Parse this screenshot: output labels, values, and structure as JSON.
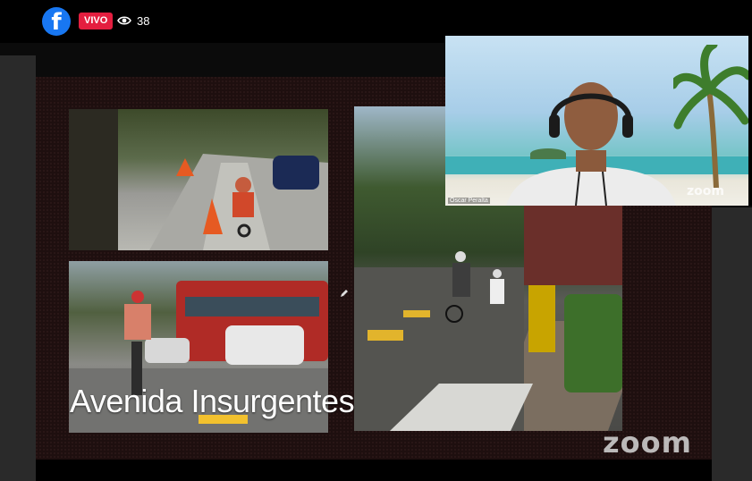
{
  "stream": {
    "platform_icon": "facebook-icon",
    "live_badge": "VIVO",
    "viewers_icon": "eye-icon",
    "viewer_count": "38"
  },
  "slide": {
    "caption": "Avenida Insurgentes",
    "watermark": "zoom",
    "photos": [
      {
        "name": "bike-lane-cyclists-photo"
      },
      {
        "name": "bus-and-cyclist-photo"
      },
      {
        "name": "street-crossing-cyclists-photo"
      }
    ]
  },
  "camera": {
    "participant_name": "Oscar Peralta",
    "brand_tag": "zoom",
    "colors": {
      "sky": "#a7cde8",
      "sea": "#3fb0b7"
    }
  },
  "colors": {
    "live": "#e41e3f",
    "facebook": "#1877f2",
    "slide_bg": "#1e0f0f"
  }
}
